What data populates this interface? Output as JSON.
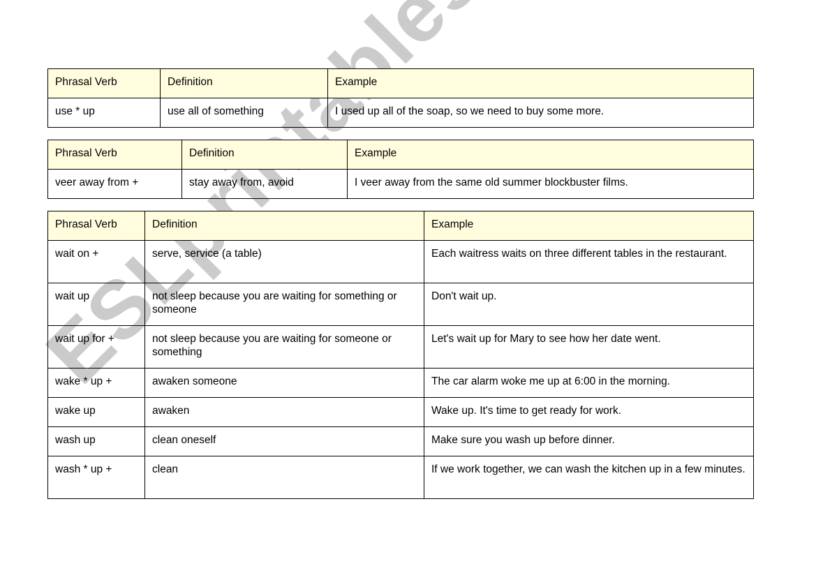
{
  "watermark": "ESLprintables.com",
  "header_color": "#fffdde",
  "tables": [
    {
      "headers": [
        "Phrasal Verb",
        "Definition",
        "Example"
      ],
      "rows": [
        [
          "use * up",
          "use all of something",
          "I used up all of the soap, so we need to buy some more."
        ]
      ]
    },
    {
      "headers": [
        "Phrasal Verb",
        "Definition",
        "Example"
      ],
      "rows": [
        [
          "veer away from +",
          "stay away from, avoid",
          "I veer away from the same old summer blockbuster films."
        ]
      ]
    },
    {
      "headers": [
        "Phrasal Verb",
        "Definition",
        "Example"
      ],
      "rows": [
        [
          "wait on +",
          "serve, service (a table)",
          "Each waitress waits on three different tables in the restaurant."
        ],
        [
          "wait up",
          "not sleep because you are waiting for something or someone",
          "Don't wait up."
        ],
        [
          "wait up for +",
          "not sleep because you are waiting for someone or something",
          "Let's wait up for Mary to see how her date went."
        ],
        [
          "wake * up +",
          "awaken someone",
          "The car alarm woke me up at 6:00 in the morning."
        ],
        [
          "wake up",
          "awaken",
          "Wake up. It's time to get ready for work."
        ],
        [
          "wash up",
          "clean oneself",
          "Make sure you wash up before dinner."
        ],
        [
          "wash * up +",
          "clean",
          "If we work together, we can wash the kitchen up in a few minutes."
        ]
      ]
    }
  ]
}
